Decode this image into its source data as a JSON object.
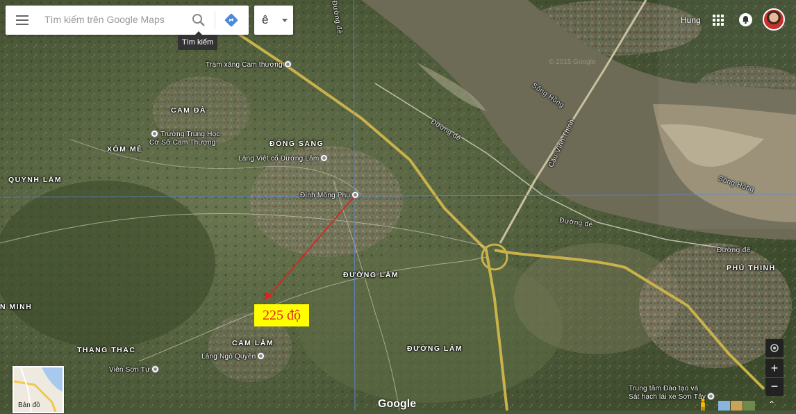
{
  "search": {
    "placeholder": "Tìm kiếm trên Google Maps",
    "button_tooltip": "Tìm kiếm"
  },
  "language": {
    "value": "ê"
  },
  "account": {
    "user_name": "Hung"
  },
  "annotation": {
    "text": "225 độ",
    "arrow_color": "#e02020",
    "box_color": "#ffff00"
  },
  "map": {
    "places": [
      {
        "name": "CAM ĐÀ"
      },
      {
        "name": "XÓM MÈ"
      },
      {
        "name": "QUỲNH LÂM"
      },
      {
        "name": "ĐÔNG SÀNG"
      },
      {
        "name": "ĐƯỜNG LÂM"
      },
      {
        "name": "ĐƯỜNG LÂM"
      },
      {
        "name": "CAM LÂM"
      },
      {
        "name": "THẠNG THẠC"
      },
      {
        "name": "N MINH"
      },
      {
        "name": "PHÚ THỊNH"
      }
    ],
    "pois": [
      {
        "name": "Trạm xăng Cam thượng"
      },
      {
        "name": "Trường Trung Học\nCơ Sở Cam Thượng"
      },
      {
        "name": "Làng Việt cổ Đường Lâm"
      },
      {
        "name": "Đình Mông Phụ"
      },
      {
        "name": "Làng Ngô Quyền"
      },
      {
        "name": "Viên Sơn Tự"
      },
      {
        "name": "Trung tâm Đào tạo và\nSát hạch lái xe Sơn Tây"
      }
    ],
    "roads": [
      {
        "name": "Đường đê"
      },
      {
        "name": "Đường đê"
      },
      {
        "name": "Đường đê"
      },
      {
        "name": "Đường đê"
      },
      {
        "name": "Cầu Vĩnh Thịnh"
      }
    ],
    "rivers": [
      {
        "name": "Sông Hồng"
      },
      {
        "name": "Sông Hồng"
      }
    ],
    "watermark": "© 2015 Google"
  },
  "minimap": {
    "label": "Bản đồ"
  },
  "controls": {
    "zoom_in": "+",
    "zoom_out": "−"
  },
  "logo": "Google"
}
